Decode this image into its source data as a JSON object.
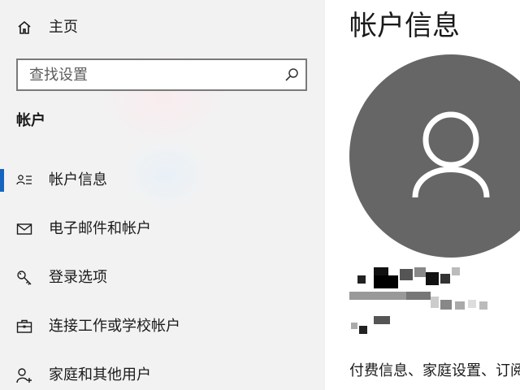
{
  "sidebar": {
    "home_label": "主页",
    "search_placeholder": "查找设置",
    "search_value": "",
    "section_title": "帐户",
    "items": [
      {
        "label": "帐户信息",
        "icon": "account-info-icon",
        "selected": true
      },
      {
        "label": "电子邮件和帐户",
        "icon": "mail-icon",
        "selected": false
      },
      {
        "label": "登录选项",
        "icon": "key-icon",
        "selected": false
      },
      {
        "label": "连接工作或学校帐户",
        "icon": "briefcase-icon",
        "selected": false
      },
      {
        "label": "家庭和其他用户",
        "icon": "person-add-icon",
        "selected": false
      }
    ]
  },
  "main": {
    "title": "帐户信息",
    "bottom_text": "付费信息、家庭设置、订阅"
  },
  "colors": {
    "accent": "#1565c0",
    "avatar_bg": "#666666",
    "sidebar_bg": "#f2f2f2"
  }
}
